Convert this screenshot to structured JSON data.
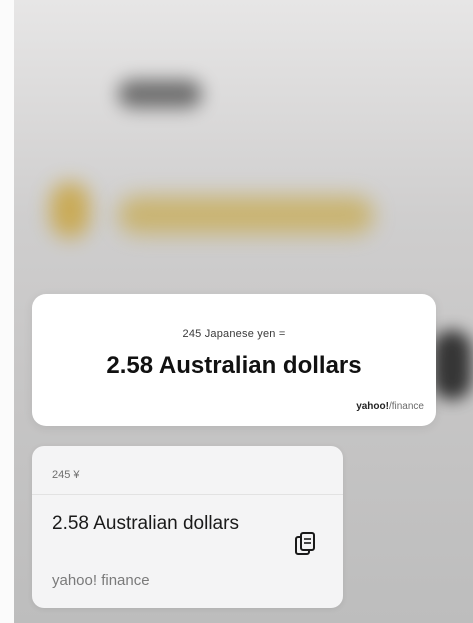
{
  "result_card": {
    "query": "245 Japanese yen =",
    "answer": "2.58 Australian dollars",
    "source_brand": "yahoo!",
    "source_suffix": "finance"
  },
  "suggestion_card": {
    "query": "245 ¥",
    "answer": "2.58 Australian dollars",
    "source": "yahoo! finance",
    "copy_icon": "copy-icon"
  }
}
